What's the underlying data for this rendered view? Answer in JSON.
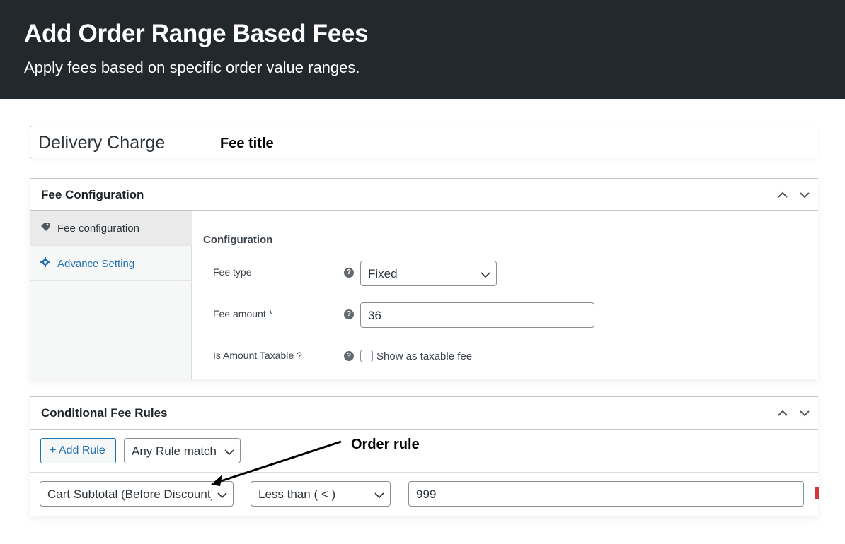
{
  "banner": {
    "title": "Add Order Range Based Fees",
    "subtitle": "Apply fees based on specific order value ranges."
  },
  "fee_title": {
    "value": "Delivery Charge",
    "annotation": "Fee title"
  },
  "fee_configuration": {
    "heading": "Fee Configuration",
    "sidebar": [
      {
        "label": "Fee configuration",
        "icon": "tag-icon",
        "active": true
      },
      {
        "label": "Advance Setting",
        "icon": "gear-icon",
        "active": false
      }
    ],
    "section_title": "Configuration",
    "fields": {
      "fee_type": {
        "label": "Fee type",
        "value": "Fixed"
      },
      "fee_amount": {
        "label": "Fee amount *",
        "value": "36"
      },
      "taxable": {
        "label": "Is Amount Taxable ?",
        "checkbox_label": "Show as taxable fee",
        "checked": false
      }
    }
  },
  "conditional_rules": {
    "heading": "Conditional Fee Rules",
    "add_rule_label": "+ Add Rule",
    "match_select": "Any Rule match",
    "annotation": "Order rule",
    "rule": {
      "condition": "Cart Subtotal (Before Discount)",
      "operator": "Less than ( < )",
      "value": "999"
    }
  },
  "colors": {
    "banner_bg": "#23282d",
    "link": "#2271b1",
    "delete": "#d63638"
  }
}
